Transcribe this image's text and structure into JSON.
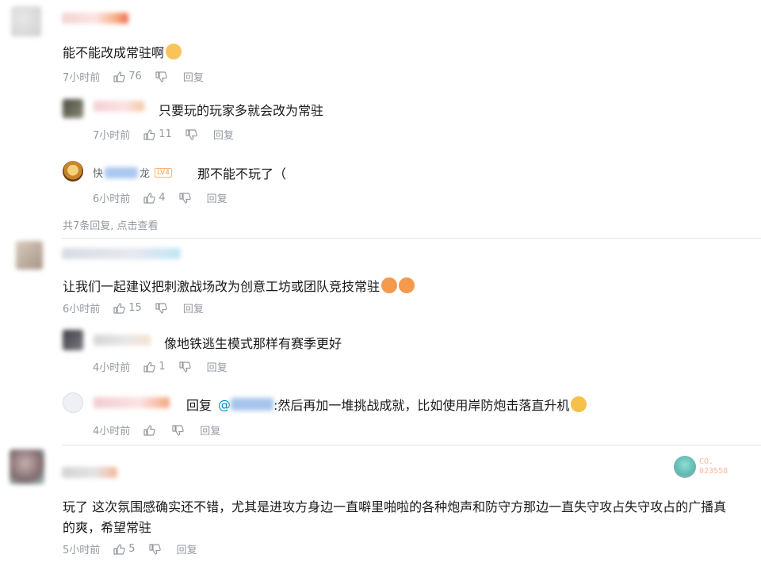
{
  "comments": [
    {
      "text": "能不能改成常驻啊",
      "time": "7小时前",
      "likes": "76",
      "reply_label": "回复",
      "replies": [
        {
          "text": "只要玩的玩家多就会改为常驻",
          "time": "7小时前",
          "likes": "11",
          "reply_label": "回复"
        },
        {
          "name_prefix": "快",
          "name_suffix": "龙",
          "level": "LV4",
          "text": "那不能不玩了（",
          "time": "6小时前",
          "likes": "4",
          "reply_label": "回复"
        }
      ],
      "view_more": "共7条回复, 点击查看"
    },
    {
      "text": "让我们一起建议把刺激战场改为创意工坊或团队竞技常驻",
      "time": "6小时前",
      "likes": "15",
      "reply_label": "回复",
      "replies": [
        {
          "text": "像地铁逃生模式那样有赛季更好",
          "time": "4小时前",
          "likes": "1",
          "reply_label": "回复"
        },
        {
          "reply_prefix": "回复",
          "at": "@",
          "text": ":然后再加一堆挑战成就，比如使用岸防炮击落直升机",
          "time": "4小时前",
          "likes": "",
          "reply_label": "回复"
        }
      ]
    },
    {
      "text_line1": "玩了 这次氛围感确实还不错，尤其是进攻方身边一直噼里啪啦的各种炮声和防守方那边一直失守攻占失守攻占的广播真",
      "text_line2": "的爽，希望常驻",
      "time": "5小时前",
      "likes": "5",
      "reply_label": "回复",
      "badge_line1": "CO.",
      "badge_line2": "023558"
    }
  ],
  "icons": [
    "thumbs-up-icon",
    "thumbs-down-icon"
  ],
  "colors": {
    "meta": "#9499a0",
    "text": "#18191c",
    "link": "#008ac5",
    "divider": "#e3e5e7",
    "level": "#ff9f43"
  }
}
